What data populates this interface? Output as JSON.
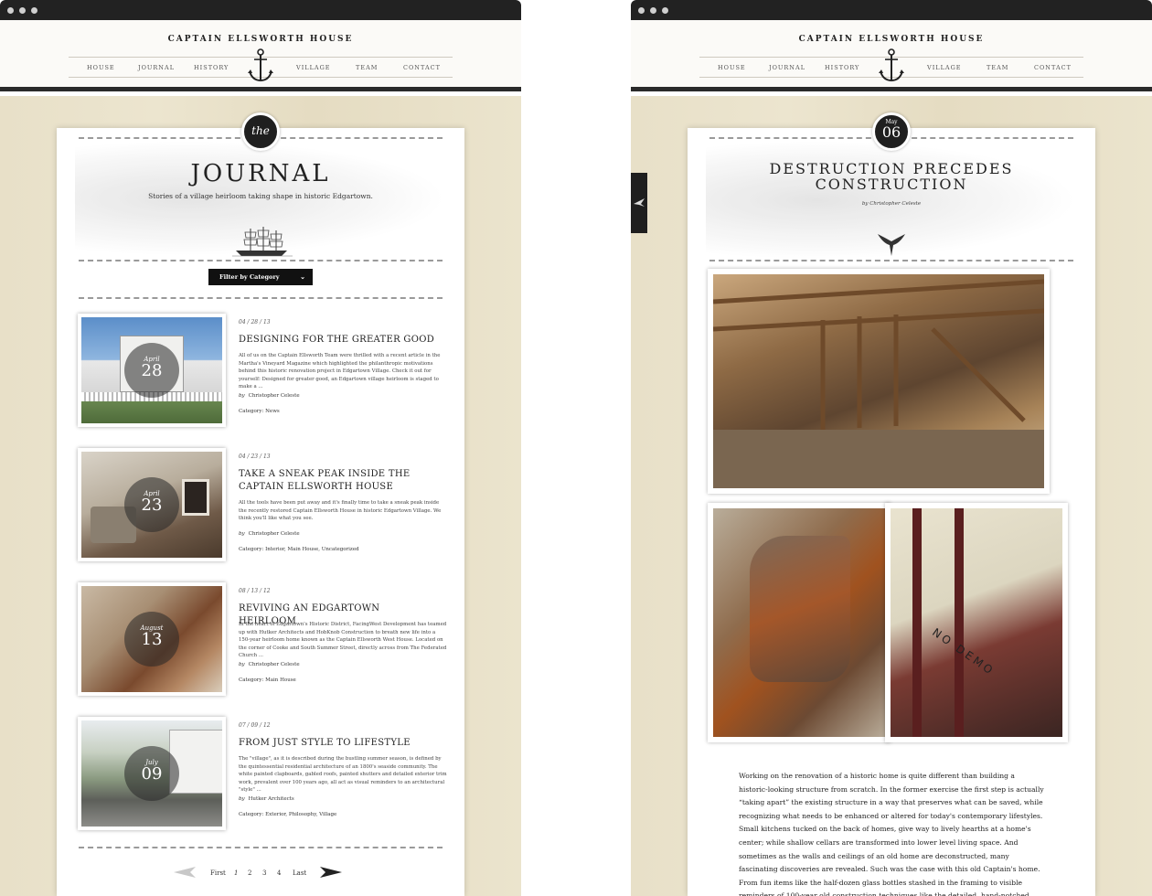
{
  "site": {
    "brand": "CAPTAIN ELLSWORTH HOUSE",
    "nav": [
      "HOUSE",
      "JOURNAL",
      "HISTORY",
      "VILLAGE",
      "TEAM",
      "CONTACT"
    ]
  },
  "journal": {
    "badge": "the",
    "title": "JOURNAL",
    "subtitle": "Stories of a village heirloom taking shape in historic Edgartown.",
    "filter_label": "Filter by Category",
    "posts": [
      {
        "date": "04 / 28 / 13",
        "month": "April",
        "day": "28",
        "title": "DESIGNING FOR THE GREATER GOOD",
        "excerpt": "All of us on the Captain Ellsworth Team were thrilled with a recent article in the Martha's Vineyard Magazine which highlighted the philanthropic motivations behind this historic renovation project in Edgartown Village. Check it out for yourself: Designed for greater good, an Edgartown village heirloom is staged to make a ...",
        "by": "by",
        "author": "Christopher Celeste",
        "category": "Category: News"
      },
      {
        "date": "04 / 23 / 13",
        "month": "April",
        "day": "23",
        "title": "TAKE A SNEAK PEAK INSIDE THE CAPTAIN ELLSWORTH HOUSE",
        "excerpt": "All the tools have been put away and it's finally time to take a sneak peak inside the recently restored Captain Ellsworth House in historic Edgartown Village. We think you'll like what you see.",
        "by": "by",
        "author": "Christopher Celeste",
        "category": "Category: Interior, Main House, Uncategorized"
      },
      {
        "date": "08 / 13 / 12",
        "month": "August",
        "day": "13",
        "title": "REVIVING AN EDGARTOWN HEIRLOOM",
        "excerpt": "In the heart of Edgartown's Historic District, FacingWest Development has teamed up with Hutker Architects and HobKnob Construction to breath new life into a 150-year heirloom home known as the Captain Ellsworth West House. Located on the corner of Cooke and South Summer Street, directly across from The Federated Church ...",
        "by": "by",
        "author": "Christopher Celeste",
        "category": "Category: Main House"
      },
      {
        "date": "07 / 09 / 12",
        "month": "July",
        "day": "09",
        "title": "FROM JUST STYLE TO LIFESTYLE",
        "excerpt": "The \"village\", as it is described during the bustling summer season, is defined by the quintessential residential architecture of an 1800's seaside community. The white painted clapboards, gabled roofs, painted shutters and detailed exterior trim work, prevalent over 100 years ago, all act as visual reminders to an architectural \"style\" ...",
        "by": "by",
        "author": "Hutker Architects",
        "category": "Category: Exterior, Philosophy, Village"
      }
    ],
    "pager": {
      "first": "First",
      "pages": [
        "1",
        "2",
        "3",
        "4"
      ],
      "last": "Last"
    }
  },
  "article": {
    "badge_month": "May",
    "badge_day": "06",
    "title_line1": "DESTRUCTION PRECEDES",
    "title_line2": "CONSTRUCTION",
    "byline": "by Christopher Celeste",
    "photo_text": "NO DEMO",
    "body": "Working on the renovation of a historic home is quite different than building a historic-looking structure from scratch. In the former exercise the first step is actually “taking apart” the existing structure in a way that preserves what can be saved, while recognizing what needs to be enhanced or altered for today's contemporary lifestyles. Small kitchens tucked on the back of homes, give way to lively hearths at a home's center; while shallow cellars are transformed into lower level living space. And sometimes as the walls and ceilings of an old home are deconstructed, many fascinating discoveries are revealed. Such was the case with this old Captain's home. From fun items like the half-dozen glass bottles stashed in the framing to visible reminders of 100-year old construction techniques like the detailed, hand-notched beams that supported the second floor, the"
  }
}
